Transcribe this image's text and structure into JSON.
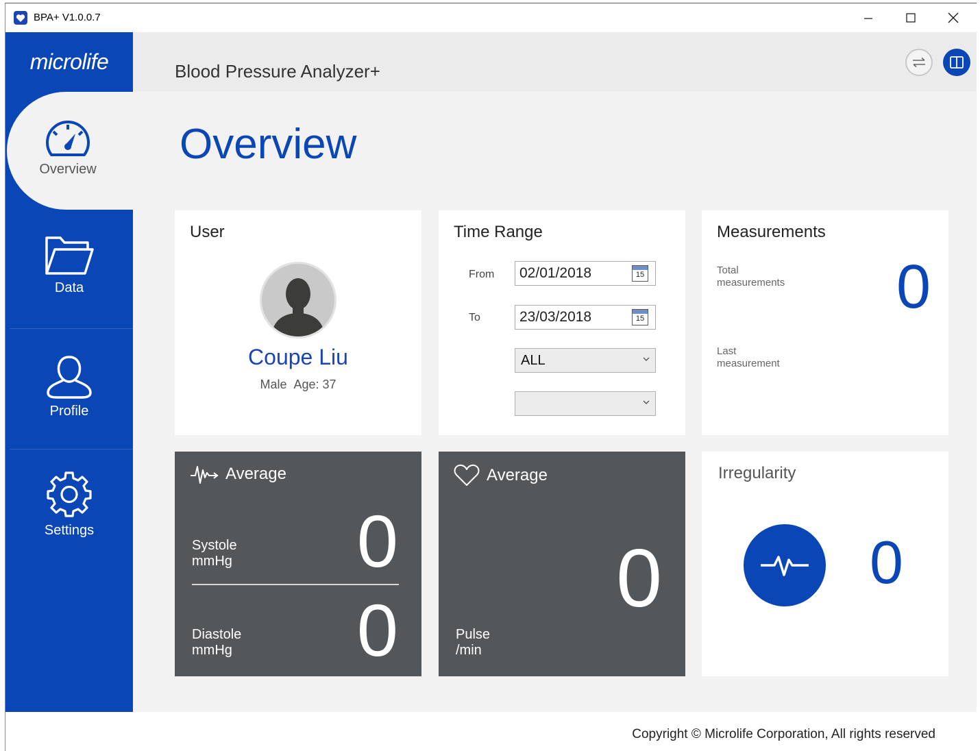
{
  "window": {
    "title": "BPA+ V1.0.0.7"
  },
  "sidebar": {
    "brand": "microlife",
    "items": [
      {
        "label": "Overview",
        "icon": "speedometer-icon",
        "active": true
      },
      {
        "label": "Data",
        "icon": "folder-icon"
      },
      {
        "label": "Profile",
        "icon": "user-icon"
      },
      {
        "label": "Settings",
        "icon": "gear-icon"
      }
    ]
  },
  "header": {
    "app_name": "Blood Pressure Analyzer+",
    "sync_icon": "swap-arrows-icon",
    "manual_icon": "book-icon"
  },
  "page": {
    "title": "Overview"
  },
  "user_card": {
    "title": "User",
    "name": "Coupe Liu",
    "gender": "Male",
    "age_label": "Age: 37"
  },
  "time_range": {
    "title": "Time Range",
    "from_label": "From",
    "from_value": "02/01/2018",
    "to_label": "To",
    "to_value": "23/03/2018",
    "calendar_day": "15",
    "period_select": "ALL",
    "second_select": ""
  },
  "measurements": {
    "title": "Measurements",
    "total_label": "Total\nmeasurements",
    "total_value": "0",
    "last_label": "Last\nmeasurement"
  },
  "bp_average": {
    "title": "Average",
    "systole_label": "Systole\nmmHg",
    "systole_value": "0",
    "diastole_label": "Diastole\nmmHg",
    "diastole_value": "0"
  },
  "pulse_average": {
    "title": "Average",
    "pulse_label": "Pulse\n/min",
    "pulse_value": "0"
  },
  "irregularity": {
    "title": "Irregularity",
    "value": "0"
  },
  "footer": {
    "copyright": "Copyright © Microlife Corporation, All rights reserved"
  },
  "colors": {
    "brand_blue": "#0a46b6",
    "dark_card": "#545759",
    "background": "#f2f2f2"
  }
}
